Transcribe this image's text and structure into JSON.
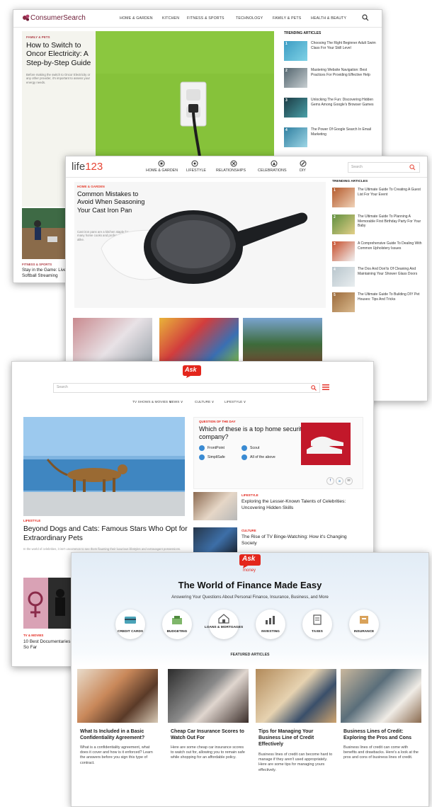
{
  "consumersearch": {
    "logo": "ConsumerSearch",
    "nav": [
      "HOME & GARDEN",
      "KITCHEN",
      "FITNESS & SPORTS",
      "TECHNOLOGY",
      "FAMILY & PETS",
      "HEALTH & BEAUTY"
    ],
    "hero": {
      "category": "FAMILY & PETS",
      "title": "How to Switch to Oncor Electricity: A Step-by-Step Guide",
      "excerpt": "Before making the switch to Oncor Electricity or any other provider, it's important to assess your energy needs."
    },
    "trending_title": "TRENDING ARTICLES",
    "trending": [
      {
        "num": "1",
        "text": "Choosing The Right Beginner Adult Swim Class For Your Skill Level"
      },
      {
        "num": "2",
        "text": "Mastering Website Navigation: Best Practices For Providing Effective Help"
      },
      {
        "num": "3",
        "text": "Unlocking The Fun: Discovering Hidden Gems Among Google's Browser Games"
      },
      {
        "num": "4",
        "text": "The Power Of Google Search In Email Marketing"
      }
    ],
    "side_story": {
      "category": "FITNESS & SPORTS",
      "title": "Stay in the Game: Live Softball Streaming"
    }
  },
  "life123": {
    "logo_a": "life",
    "logo_b": "123",
    "nav": [
      "HOME & GARDEN",
      "LIFESTYLE",
      "RELATIONSHIPS",
      "CELEBRATIONS",
      "DIY"
    ],
    "search_placeholder": "Search",
    "hero": {
      "category": "HOME & GARDEN",
      "title": "Common Mistakes to Avoid When Seasoning Your Cast Iron Pan",
      "excerpt": "Cast iron pans are a kitchen staple for many home cooks and professional chefs alike."
    },
    "trending_title": "TRENDING ARTICLES",
    "trending": [
      {
        "num": "1",
        "text": "The Ultimate Guide To Creating A Guest List For Your Event"
      },
      {
        "num": "2",
        "text": "The Ultimate Guide To Planning A Memorable First Birthday Party For Your Baby"
      },
      {
        "num": "3",
        "text": "A Comprehensive Guide To Dealing With Common Upholstery Issues"
      },
      {
        "num": "4",
        "text": "The Dos And Don'ts Of Cleaning And Maintaining Your Shower Glass Doors"
      },
      {
        "num": "5",
        "text": "The Ultimate Guide To Building DIY Pet Houses: Tips And Tricks"
      }
    ]
  },
  "ask": {
    "logo": "Ask",
    "search_placeholder": "Search",
    "nav": [
      "TV SHOWS & MOVIES ∨",
      "NEWS ∨",
      "CULTURE ∨",
      "LIFESTYLE ∨"
    ],
    "hero": {
      "category": "LIFESTYLE",
      "title": "Beyond Dogs and Cats: Famous Stars Who Opt for Extraordinary Pets",
      "excerpt": "In the world of celebrities, it isn't uncommon to see them flaunting their luxurious lifestyles and extravagant possessions."
    },
    "quiz": {
      "label": "QUESTION OF THE DAY",
      "question": "Which of these is a top home security company?",
      "options": [
        "FrontPoint",
        "Scout",
        "SimpliSafe",
        "All of the above"
      ]
    },
    "share": [
      "f",
      "in",
      "✉"
    ],
    "stories": [
      {
        "category": "LIFESTYLE",
        "title": "Exploring the Lesser-Known Talents of Celebrities: Uncovering Hidden Skills"
      },
      {
        "category": "CULTURE",
        "title": "The Rise of TV Binge-Watching: How it's Changing Society"
      }
    ],
    "bottom": {
      "category": "TV & MOVIES",
      "title": "10 Best Documentaries — So Far"
    }
  },
  "askmoney": {
    "logo": "Ask",
    "logo_sub": "money",
    "headline": "The World of Finance Made Easy",
    "subhead": "Answering Your Questions About Personal Finance, Insurance, Business, and More",
    "categories": [
      "CREDIT CARDS",
      "BUDGETING",
      "LOANS & MORTGAGES",
      "INVESTING",
      "TAXES",
      "INSURANCE"
    ],
    "featured_title": "FEATURED ARTICLES",
    "articles": [
      {
        "title": "What Is Included in a Basic Confidentiality Agreement?",
        "excerpt": "What is a confidentiality agreement, what does it cover and how is it enforced? Learn the answers before you sign this type of contract."
      },
      {
        "title": "Cheap Car Insurance Scores to Watch Out For",
        "excerpt": "Here are some cheap car insurance scores to watch out for, allowing you to remain safe while shopping for an affordable policy."
      },
      {
        "title": "Tips for Managing Your Business Line of Credit Effectively",
        "excerpt": "Business lines of credit can become hard to manage if they aren't used appropriately. Here are some tips for managing yours effectively."
      },
      {
        "title": "Business Lines of Credit: Exploring the Pros and Cons",
        "excerpt": "Business lines of credit can come with benefits and drawbacks. Here's a look at the pros and cons of business lines of credit."
      }
    ]
  }
}
